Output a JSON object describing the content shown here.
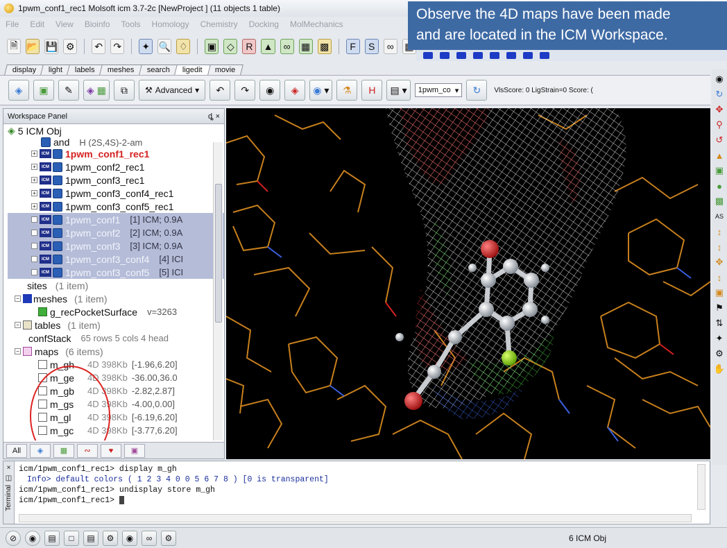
{
  "window": {
    "title": "1pwm_conf1_rec1 Molsoft icm 3.7-2c  [NewProject ] (11 objects 1 table)"
  },
  "callout": {
    "line1": "Observe the 4D maps have been made",
    "line2": "and are located in the ICM Workspace."
  },
  "menu": [
    "File",
    "Edit",
    "View",
    "Bioinfo",
    "Tools",
    "Homology",
    "Chemistry",
    "Docking",
    "MolMechanics"
  ],
  "tabs": [
    "display",
    "light",
    "labels",
    "meshes",
    "search",
    "ligedit",
    "movie"
  ],
  "active_tab": "ligedit",
  "toolbar2": {
    "advanced_label": "Advanced",
    "combo_value": "1pwm_co",
    "score_text": "VlsScore: 0 LigStrain=0 Score: ("
  },
  "workspace": {
    "title": "Workspace Panel",
    "header_controls": "ȡ ×",
    "root": "5 ICM Obj",
    "partial_row": {
      "name": "and",
      "extra": "H  (2S,4S)-2-am"
    },
    "objects": [
      {
        "name": "1pwm_conf1_rec1",
        "style": "red"
      },
      {
        "name": "1pwm_conf2_rec1",
        "style": "normal"
      },
      {
        "name": "1pwm_conf3_rec1",
        "style": "normal"
      },
      {
        "name": "1pwm_conf3_conf4_rec1",
        "style": "normal"
      },
      {
        "name": "1pwm_conf3_conf5_rec1",
        "style": "normal"
      },
      {
        "name": "1pwm_conf1",
        "style": "hl",
        "extra": "[1] ICM; 0.9A"
      },
      {
        "name": "1pwm_conf2",
        "style": "hl",
        "extra": "[2] ICM; 0.9A"
      },
      {
        "name": "1pwm_conf3",
        "style": "hl",
        "extra": "[3] ICM; 0.9A"
      },
      {
        "name": "1pwm_conf3_conf4",
        "style": "hl",
        "extra": "[4] ICI"
      },
      {
        "name": "1pwm_conf3_conf5",
        "style": "hl",
        "extra": "[5] ICI"
      }
    ],
    "sites": {
      "label": "sites",
      "count": "(1 item)"
    },
    "meshes": {
      "label": "meshes",
      "count": "(1 item)",
      "child": "g_recPocketSurface",
      "child_meta": "v=3263"
    },
    "tables": {
      "label": "tables",
      "count": "(1 item)",
      "child": "confStack",
      "child_meta": "65 rows 5 cols 4 head"
    },
    "maps": {
      "label": "maps",
      "count": "(6 items)",
      "items": [
        {
          "name": "m_gh",
          "tag": "4D 398Kb",
          "range": "[-1.96,6.20]"
        },
        {
          "name": "m_ge",
          "tag": "4D 398Kb",
          "range": "-36.00,36.0"
        },
        {
          "name": "m_gb",
          "tag": "4D 398Kb",
          "range": "-2.82,2.87]"
        },
        {
          "name": "m_gs",
          "tag": "4D 398Kb",
          "range": "-4.00,0.00]"
        },
        {
          "name": "m_gl",
          "tag": "4D 398Kb",
          "range": "[-6.19,6.20]"
        },
        {
          "name": "m_gc",
          "tag": "4D 398Kb",
          "range": "[-3.77,6.20]"
        }
      ]
    },
    "bottom_tabs": [
      "All"
    ]
  },
  "terminal": {
    "label": "Terminal",
    "lines": [
      {
        "text": "icm/1pwm_conf1_rec1> display m_gh",
        "kind": "cmd"
      },
      {
        "text": "Info> default colors ( 1 2 3 4 0 0 5 6 7 8 ) [0 is transparent]",
        "kind": "info"
      },
      {
        "text": "icm/1pwm_conf1_rec1> undisplay store m_gh",
        "kind": "cmd"
      },
      {
        "text": "icm/1pwm_conf1_rec1> ",
        "kind": "prompt"
      }
    ]
  },
  "statusbar": {
    "status": "6 ICM Obj"
  },
  "colors": {
    "callout_bg": "#3e6aa4",
    "highlight_red": "#d42020",
    "selection": "#b4bcd8",
    "viewport_bg": "#000000",
    "stick_orange": "#d2871f"
  }
}
